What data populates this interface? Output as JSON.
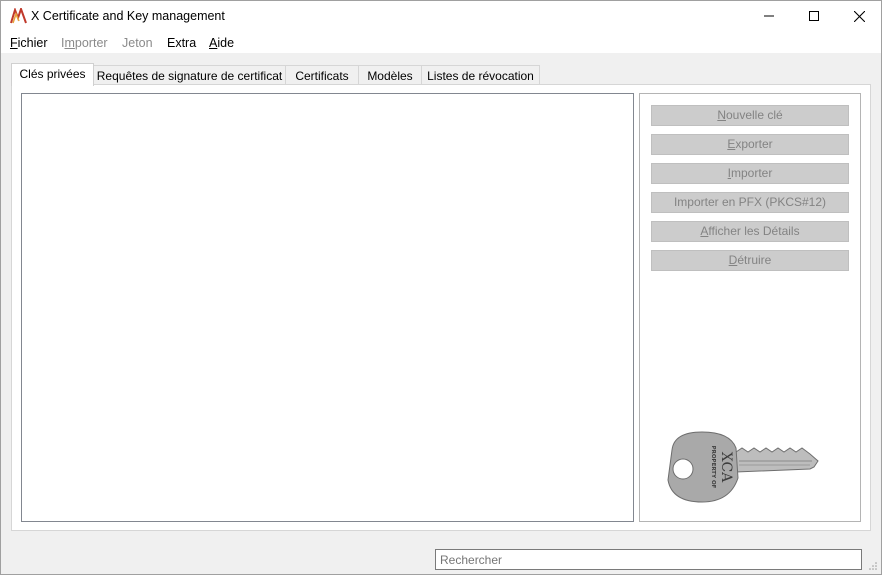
{
  "window": {
    "title": "X Certificate and Key management",
    "icon": "xca-app-icon"
  },
  "menu": [
    {
      "label": "Fichier",
      "underline": "F",
      "enabled": true
    },
    {
      "label": "Importer",
      "underline": "m",
      "enabled": false
    },
    {
      "label": "Jeton",
      "underline": "",
      "enabled": false
    },
    {
      "label": "Extra",
      "underline": "",
      "enabled": true
    },
    {
      "label": "Aide",
      "underline": "A",
      "enabled": true
    }
  ],
  "tabs": [
    {
      "label": "Clés privées",
      "active": true
    },
    {
      "label": "Requêtes de signature de certificat",
      "active": false
    },
    {
      "label": "Certificats",
      "active": false
    },
    {
      "label": "Modèles",
      "active": false
    },
    {
      "label": "Listes de révocation",
      "active": false
    }
  ],
  "actions": [
    {
      "label": "Nouvelle clé",
      "enabled": false
    },
    {
      "label": "Exporter",
      "enabled": false
    },
    {
      "label": "Importer",
      "enabled": false
    },
    {
      "label": "Importer en PFX (PKCS#12)",
      "enabled": false
    },
    {
      "label": "Afficher les Détails",
      "enabled": false
    },
    {
      "label": "Détruire",
      "enabled": false
    }
  ],
  "key_image": {
    "engraving_top": "PROPERTY OF",
    "engraving_main": "XCA"
  },
  "search": {
    "placeholder": "Rechercher",
    "value": ""
  },
  "colors": {
    "disabled_button_bg": "#cccccc",
    "disabled_text": "#838383",
    "key_gray": "#a9a9a9"
  }
}
